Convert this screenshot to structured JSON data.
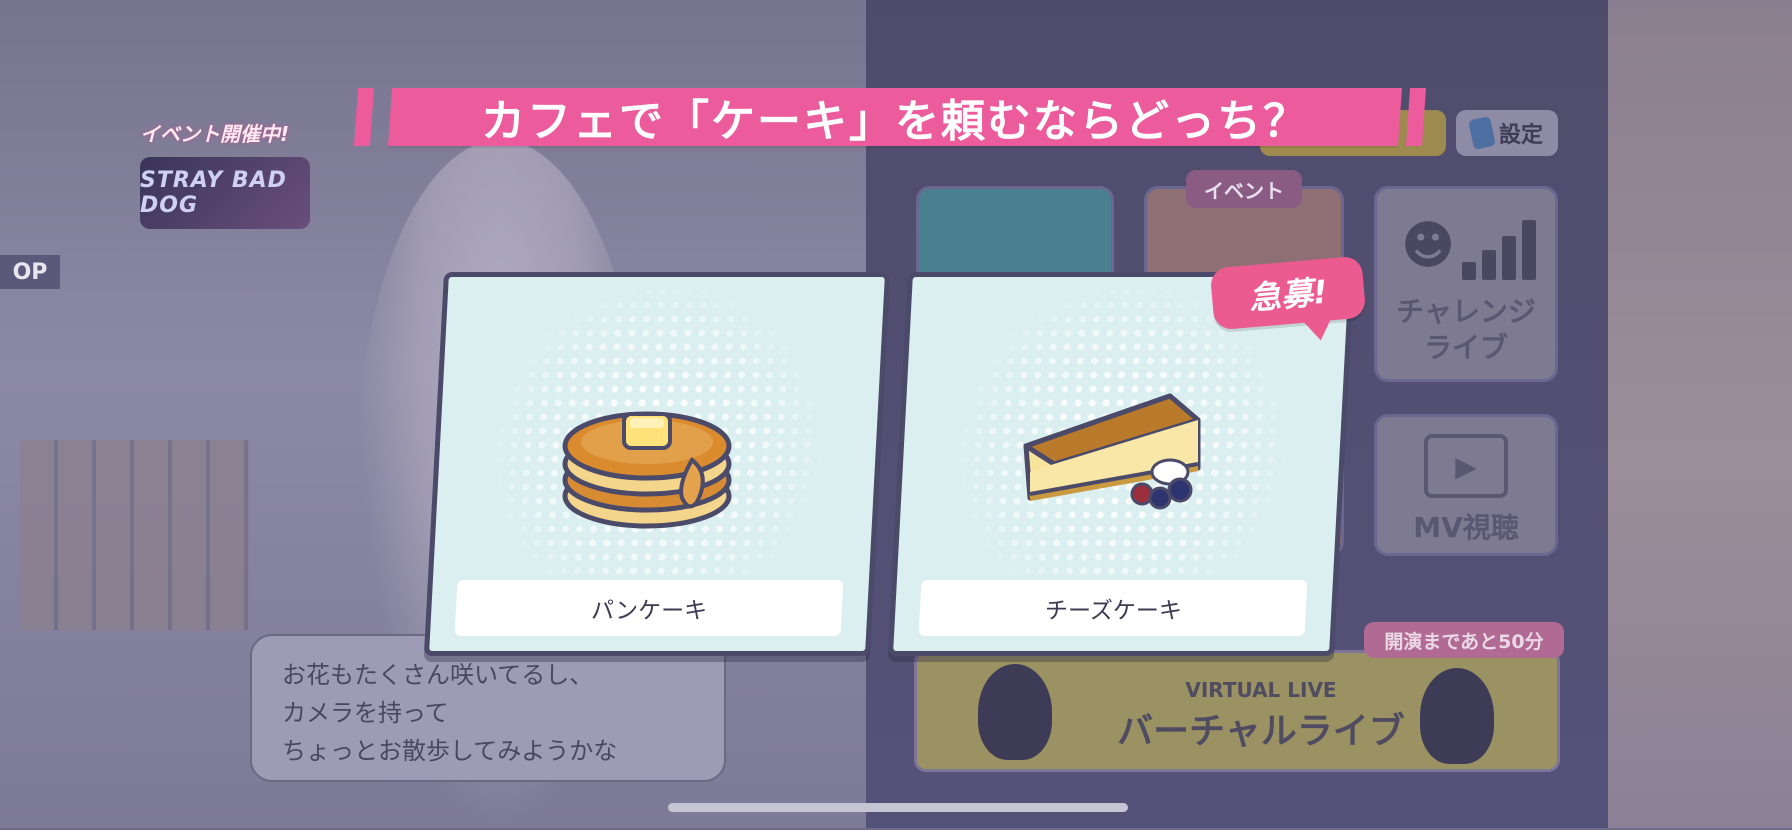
{
  "question": "カフェで「ケーキ」を頼むならどっち？",
  "choices": [
    {
      "label": "パンケーキ",
      "icon": "pancake-icon"
    },
    {
      "label": "チーズケーキ",
      "icon": "cheesecake-icon"
    }
  ],
  "urgent_badge": "急募!",
  "background": {
    "event_tag": "イベント開催中!",
    "event_logo": "STRAY BAD DOG",
    "shop_sign": "OP",
    "dialogue_lines": [
      "お花もたくさん咲いてるし、",
      "カメラを持って",
      "ちょっとお散歩してみようかな"
    ],
    "settings_label": "設定",
    "event_tab": "イベント",
    "challenge_live": [
      "チャレンジ",
      "ライブ"
    ],
    "mv_label": "MV視聴",
    "virtual_live_small": "VIRTUAL LIVE",
    "virtual_live_main": "バーチャルライブ",
    "virtual_live_badge": "開演まであと50分"
  },
  "colors": {
    "accent_pink": "#ec5b9c",
    "card_bg": "#dbeff0",
    "card_border": "#4c4a69"
  }
}
